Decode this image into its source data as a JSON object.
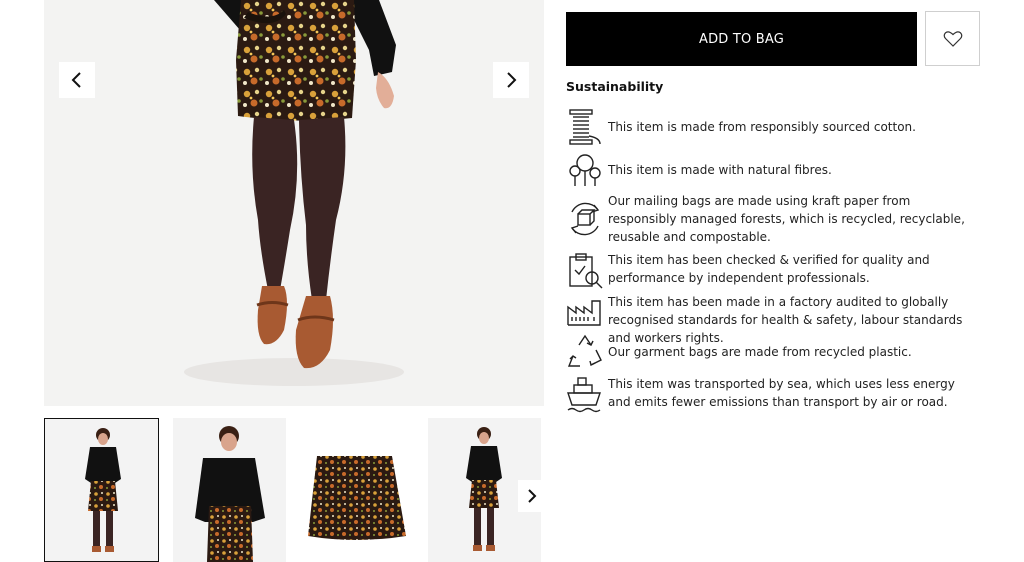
{
  "product": {
    "add_to_bag_label": "ADD TO BAG",
    "wishlist_icon": "heart-icon"
  },
  "gallery": {
    "prev_icon": "chevron-left-icon",
    "next_icon": "chevron-right-icon",
    "thumbs_next_icon": "chevron-right-icon",
    "thumbnail_count_visible": 4,
    "active_thumbnail": 1
  },
  "sustainability": {
    "title": "Sustainability",
    "items": [
      {
        "icon": "thread-spool-icon",
        "text": "This item is made from responsibly sourced cotton."
      },
      {
        "icon": "trees-icon",
        "text": "This item is made with natural fibres."
      },
      {
        "icon": "recycled-box-icon",
        "text": "Our mailing bags are made using kraft paper from responsibly managed forests, which is recycled, recyclable, reusable and compostable."
      },
      {
        "icon": "clipboard-check-icon",
        "text": "This item has been checked & verified for quality and performance by independent professionals."
      },
      {
        "icon": "factory-icon",
        "text": "This item has been made in a factory audited to globally recognised standards for health & safety, labour standards and workers rights."
      },
      {
        "icon": "recycle-icon",
        "text": "Our garment bags are made from recycled plastic."
      },
      {
        "icon": "ship-icon",
        "text": "This item was transported by sea, which uses less energy and emits fewer emissions than transport by air or road."
      }
    ]
  },
  "colors": {
    "primary_button": "#000000",
    "gallery_bg": "#f2f2f2",
    "tights": "#3a2423",
    "shoes": "#a85a32",
    "skirt_base": "#2b1a12"
  }
}
